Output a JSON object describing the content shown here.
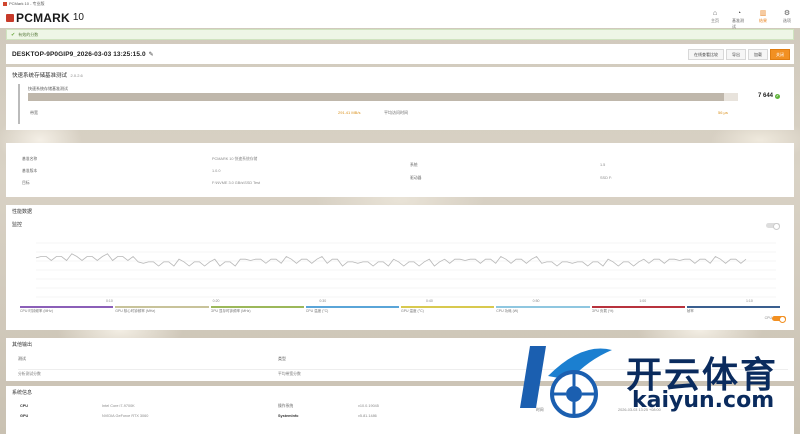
{
  "window": {
    "title": "PCMark 10 - 专业版"
  },
  "header": {
    "logo_text": "PCMARK",
    "logo_version": "10",
    "nav": [
      {
        "label": "主页",
        "icon": "home-icon",
        "glyph": "⌂"
      },
      {
        "label": "基准测试",
        "icon": "gauge-icon",
        "glyph": "◔"
      },
      {
        "label": "结果",
        "icon": "bar-chart-icon",
        "glyph": "▥"
      },
      {
        "label": "选项",
        "icon": "gear-icon",
        "glyph": "⚙"
      }
    ]
  },
  "notice": {
    "text": "有效的分数"
  },
  "result": {
    "title": "DESKTOP-9P0GIP9_2026-03-03 13:25:15.0",
    "actions": [
      "在线查看比较",
      "导出",
      "加载",
      "关闭"
    ]
  },
  "benchmark": {
    "title": "快速系统存储基准测试",
    "subtitle": "2.0.2.6",
    "test_name": "快速系统存储基准测试",
    "score": "7 644",
    "score_fraction": 0.98,
    "bandwidth_label": "带宽",
    "bandwidth_value": "291.41 MB/s",
    "latency_label": "平均访问时间",
    "latency_value": "56 μs"
  },
  "sysinfo": {
    "left": [
      {
        "k": "基准名称",
        "v": "PCMARK 10 快速系统存储"
      },
      {
        "k": "基准版本",
        "v": "1.0.0"
      },
      {
        "k": "目标",
        "v": "F:\\NVME 3.0 GB/s\\SSD Test"
      }
    ],
    "right": [
      {
        "k": "系统",
        "v": "1.5"
      },
      {
        "k": "驱动器",
        "v": "SSD F:"
      }
    ]
  },
  "perf": {
    "title": "性能数据",
    "monitor_label": "监控",
    "toggle_label": "CPU"
  },
  "chart_data": {
    "type": "line",
    "x": [
      "0:10",
      "0:20",
      "0:30",
      "0:40",
      "0:50",
      "1:00",
      "1:10"
    ],
    "series": [
      {
        "name": "CPU 时钟频率",
        "values": [
          95,
          93,
          94,
          93,
          94,
          93,
          94
        ]
      }
    ],
    "legend": [
      "CPU 时钟频率 (MHz)",
      "GPU 核心时钟频率 (MHz)",
      "GPU 显存时钟频率 (MHz)",
      "CPU 温度 (°C)",
      "GPU 温度 (°C)",
      "CPU 功耗 (W)",
      "GPU 负载 (%)",
      "帧率"
    ],
    "legend_colors": [
      "#8b5fb8",
      "#c8c39a",
      "#9cb85a",
      "#5aa5d8",
      "#d8c94f",
      "#8fc7e0",
      "#b8323d",
      "#3a5f8f"
    ],
    "grid": true
  },
  "extra": {
    "title": "其他输出",
    "col1": "测试",
    "col2": "类型",
    "row1a": "分析测试分数",
    "row1b": "平均带宽分数"
  },
  "sysinfo2": {
    "title": "系统信息",
    "cpu_label": "CPU",
    "cpu_value": "Intel Core i7-9700K",
    "gpu_label": "GPU",
    "gpu_value": "NVIDIA GeForce RTX 3060",
    "os_label": "操作系统",
    "os_value": "v10.0.19045",
    "sysinfo_label": "SystemInfo",
    "sysinfo_value": "v5.81.1486",
    "time_label": "时间",
    "time_value": "2026-03-03 13:25 +08:00"
  },
  "watermark": {
    "text": "开云体育",
    "url": "kaiyun.com"
  }
}
